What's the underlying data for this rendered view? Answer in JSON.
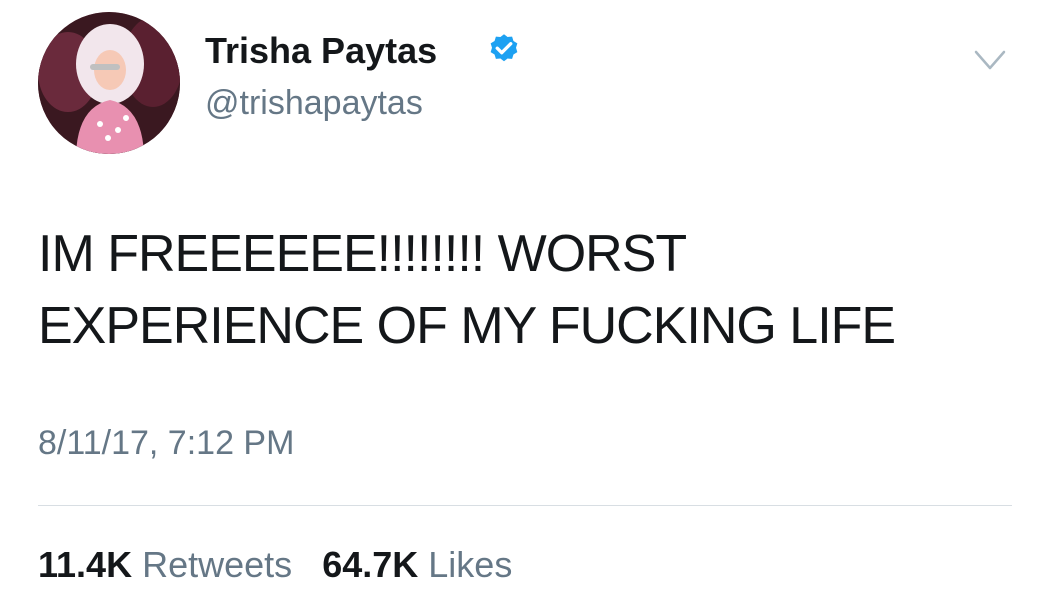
{
  "author": {
    "display_name": "Trisha Paytas",
    "handle": "@trishapaytas",
    "verified": true
  },
  "tweet": {
    "text": "IM FREEEEEE!!!!!!!! WORST EXPERIENCE OF MY FUCKING LIFE",
    "timestamp": "8/11/17, 7:12 PM"
  },
  "stats": {
    "retweets_count": "11.4K",
    "retweets_label": "Retweets",
    "likes_count": "64.7K",
    "likes_label": "Likes"
  },
  "icons": {
    "verified": "verified-badge-icon",
    "menu": "chevron-down-icon"
  },
  "colors": {
    "text": "#14171a",
    "secondary": "#657786",
    "verified_blue": "#1da1f2"
  }
}
